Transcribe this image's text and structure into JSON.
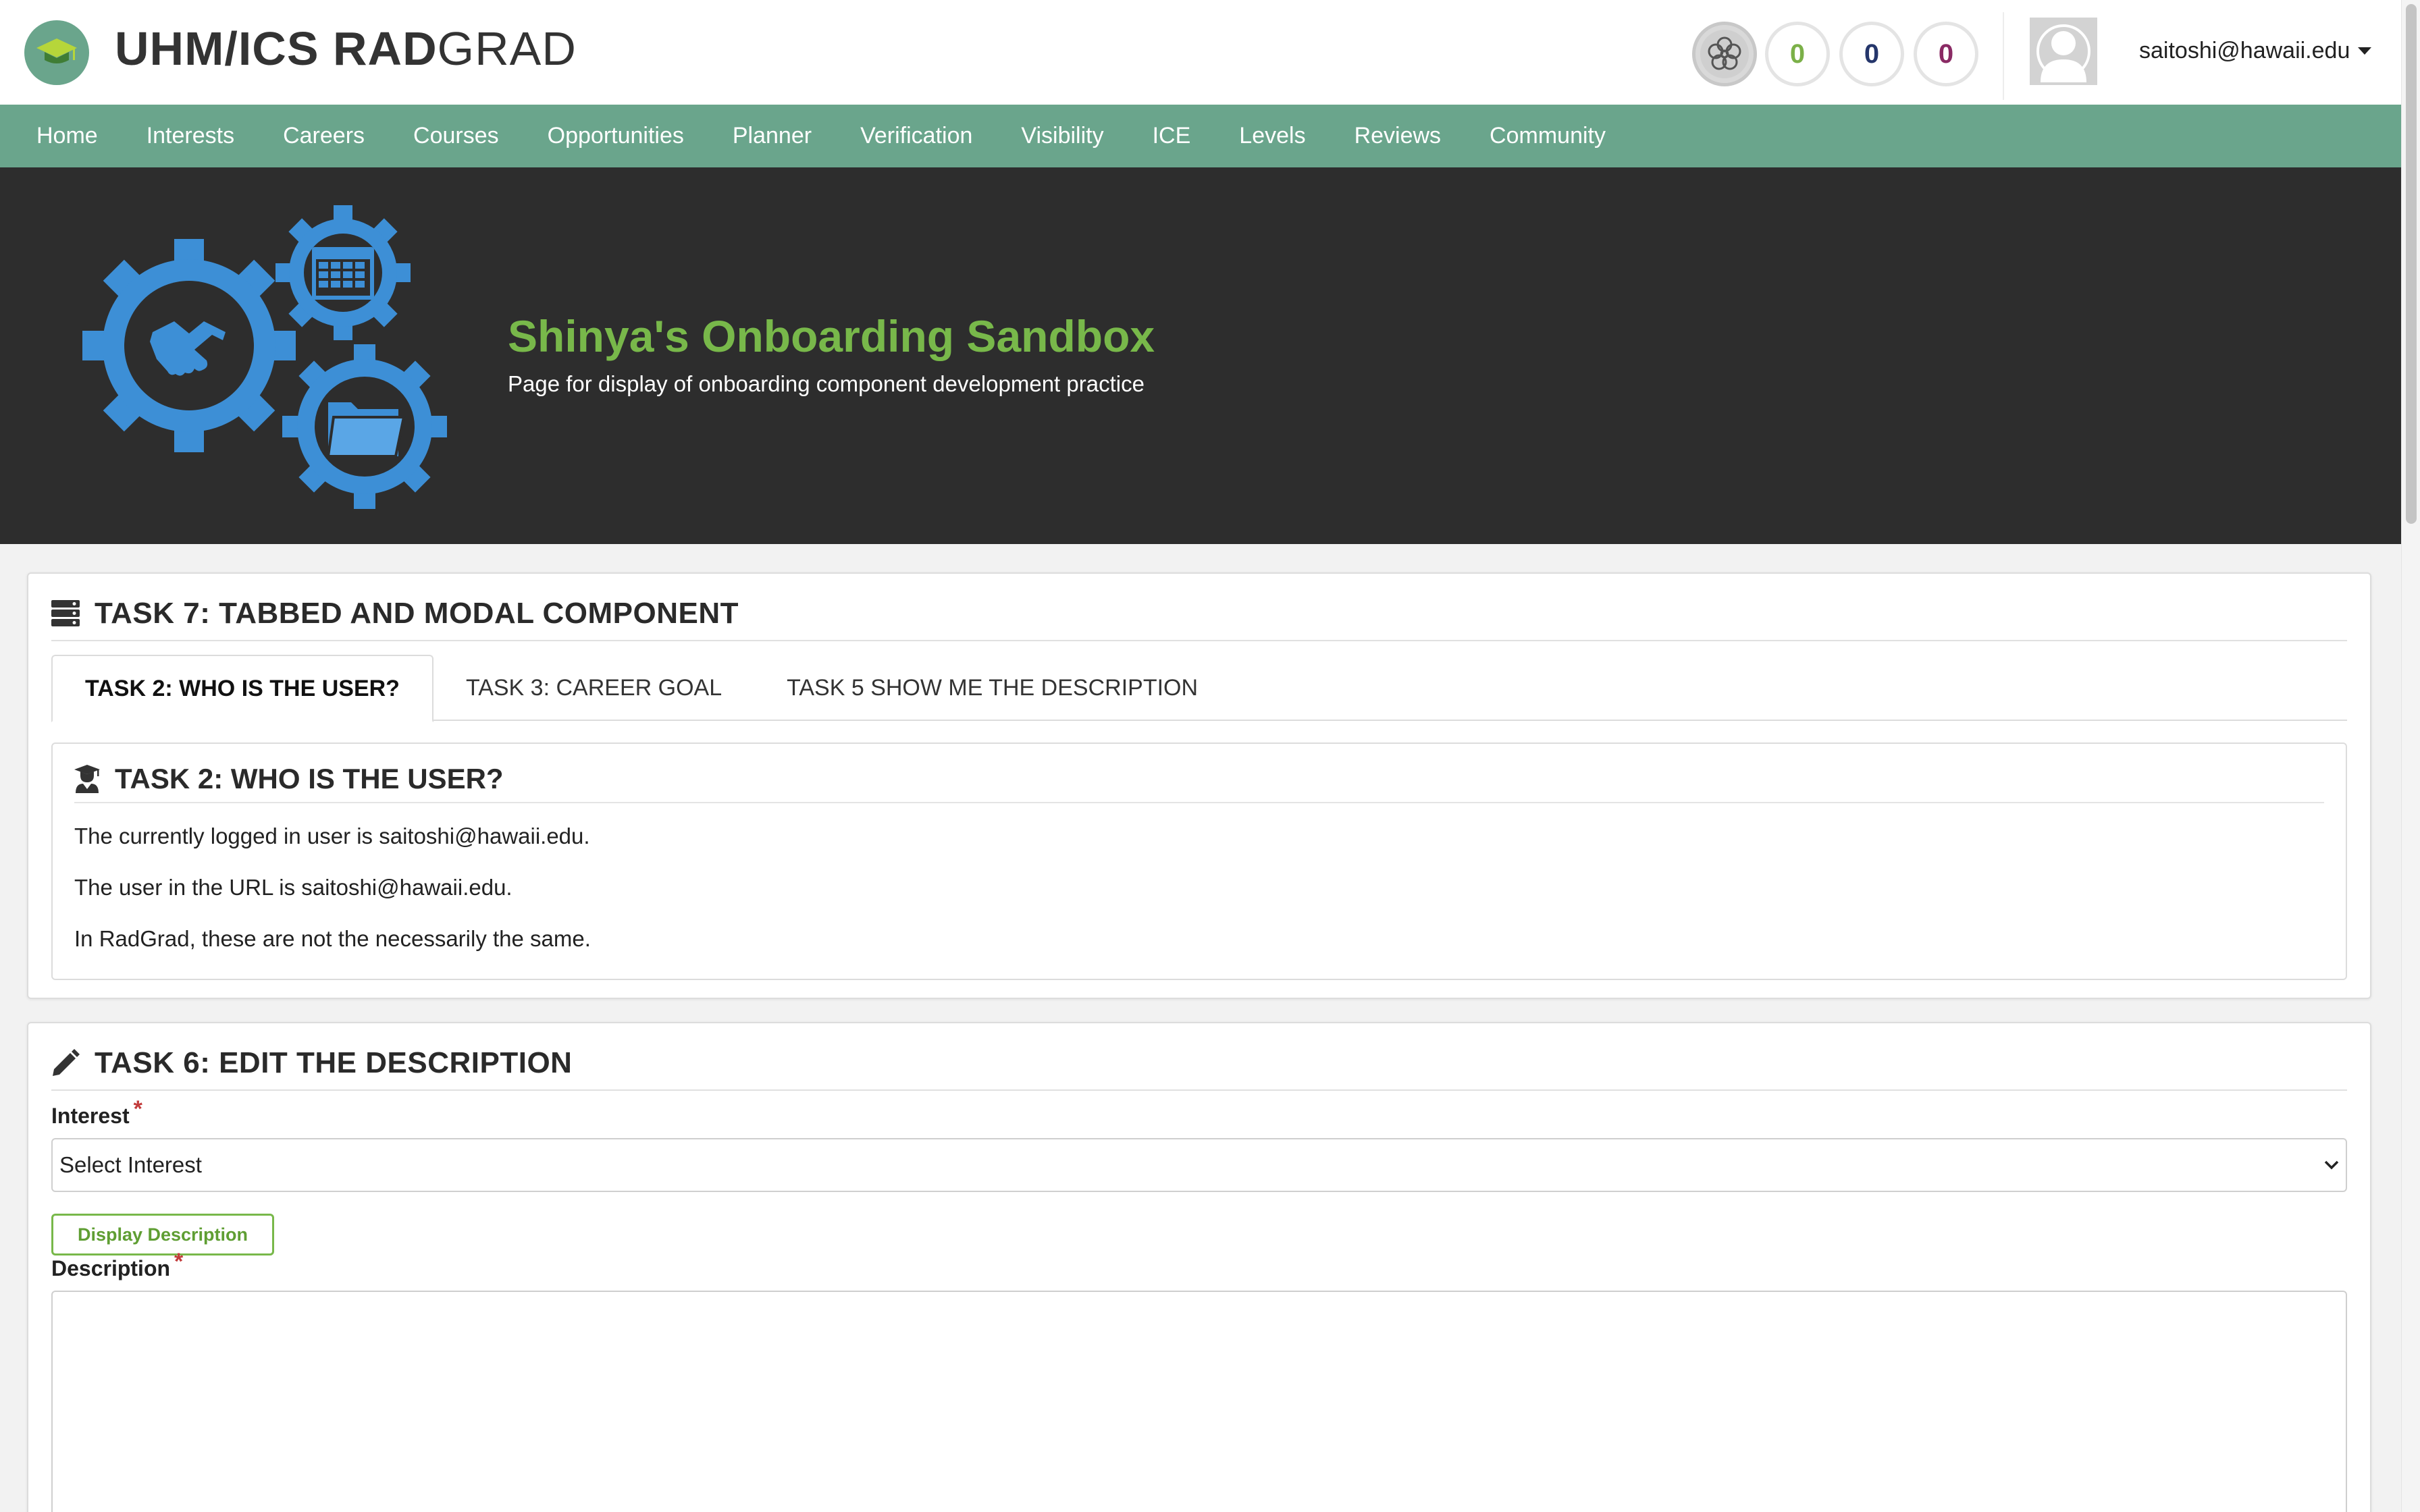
{
  "header": {
    "brand_bold": "UHM/ICS RAD",
    "brand_light": "GRAD",
    "ice": {
      "i": "0",
      "c": "0",
      "e": "0"
    },
    "user_email": "saitoshi@hawaii.edu"
  },
  "nav": {
    "items": [
      "Home",
      "Interests",
      "Careers",
      "Courses",
      "Opportunities",
      "Planner",
      "Verification",
      "Visibility",
      "ICE",
      "Levels",
      "Reviews",
      "Community"
    ]
  },
  "hero": {
    "title": "Shinya's Onboarding Sandbox",
    "subtitle": "Page for display of onboarding component development practice"
  },
  "task7": {
    "title": "TASK 7: TABBED AND MODAL COMPONENT",
    "tabs": [
      "TASK 2: WHO IS THE USER?",
      "TASK 3: CAREER GOAL",
      "TASK 5 SHOW ME THE DESCRIPTION"
    ],
    "active_tab": 0,
    "pane": {
      "title": "TASK 2: WHO IS THE USER?",
      "line1": "The currently logged in user is saitoshi@hawaii.edu.",
      "line2": "The user in the URL is saitoshi@hawaii.edu.",
      "line3": "In RadGrad, these are not the necessarily the same."
    }
  },
  "task6": {
    "title": "TASK 6: EDIT THE DESCRIPTION",
    "interest_label": "Interest",
    "required_mark": "*",
    "interest_value": "Select Interest",
    "display_button": "Display Description",
    "description_label": "Description",
    "description_value": ""
  },
  "colors": {
    "nav_green": "#6aa58c",
    "hero_bg": "#2d2d2d",
    "hero_title": "#78b84a",
    "gear_blue": "#3d8fd6",
    "ice_innovation": "#7bb048",
    "ice_competency": "#25366b",
    "ice_experience": "#8a2a64"
  },
  "icons": {
    "logo": "graduation-cap-icon",
    "level": "flower-level-icon",
    "task7": "server-list-icon",
    "pane": "user-graduate-icon",
    "task6": "pencil-icon",
    "select": "chevron-down-icon"
  }
}
